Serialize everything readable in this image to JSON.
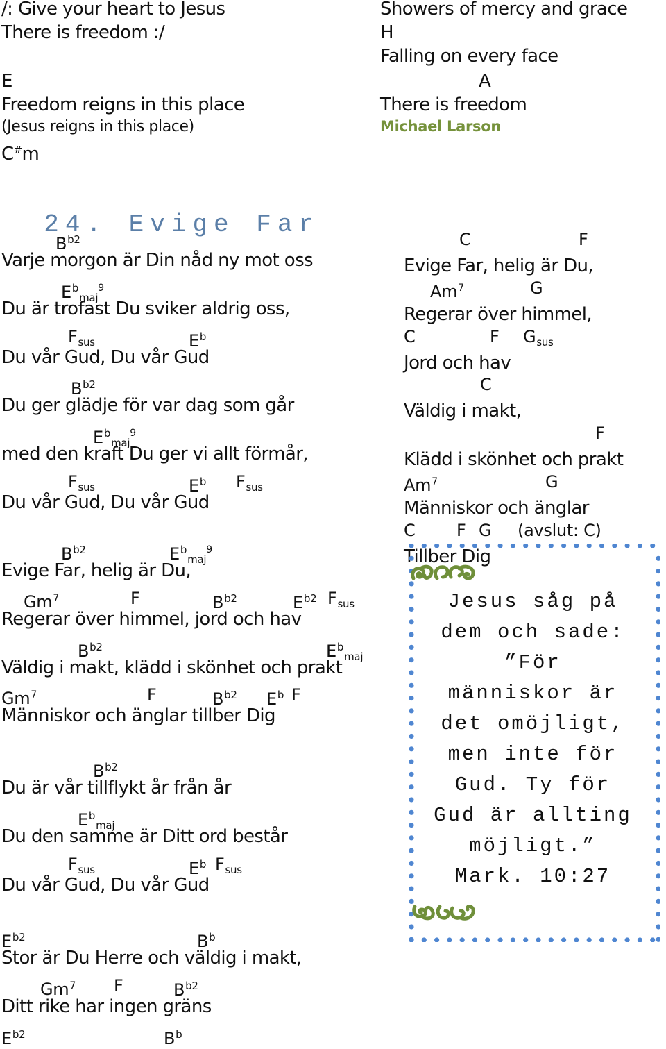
{
  "previous_song": {
    "left_lines": [
      {
        "type": "lyric",
        "text": "/: Give your heart to Jesus"
      },
      {
        "type": "lyric",
        "text": "There is freedom :/"
      },
      {
        "type": "chord",
        "text": "E"
      },
      {
        "type": "lyric",
        "text": "Freedom reigns in this place"
      },
      {
        "type": "small",
        "text": "(Jesus reigns in this place)"
      },
      {
        "type": "chord",
        "text": "C#m"
      }
    ],
    "right_lines": [
      {
        "type": "lyric",
        "text": "Showers of mercy and grace"
      },
      {
        "type": "chord",
        "text": "H"
      },
      {
        "type": "lyric",
        "text": "Falling on every face"
      },
      {
        "type": "chord",
        "text": "A"
      },
      {
        "type": "lyric",
        "text": "There is freedom"
      }
    ],
    "author": "Michael Larson"
  },
  "song": {
    "number": "24.",
    "title": "Evige Far",
    "verse1": [
      {
        "chords": [
          "Bb2"
        ],
        "lyric": "Varje morgon är Din nåd ny mot oss"
      },
      {
        "chords": [
          "Ebmaj9"
        ],
        "lyric": "Du är trofast Du sviker aldrig oss,"
      },
      {
        "chords": [
          "Fsus",
          "Eb"
        ],
        "lyric": "Du vår Gud, Du vår Gud"
      },
      {
        "chords": [
          "Bb2"
        ],
        "lyric": "Du ger glädje för var dag som går"
      },
      {
        "chords": [
          "Ebmaj9"
        ],
        "lyric": "med den kraft Du ger vi allt förmår,"
      },
      {
        "chords": [
          "Fsus",
          "Eb",
          "Fsus"
        ],
        "lyric": "Du vår Gud, Du vår Gud"
      }
    ],
    "chorus": [
      {
        "chords": [
          "Bb2",
          "Ebmaj9"
        ],
        "lyric": "Evige Far, helig är Du,"
      },
      {
        "chords": [
          "Gm7",
          "F",
          "Bb2",
          "Eb2",
          "Fsus"
        ],
        "lyric": "Regerar över himmel, jord och hav"
      },
      {
        "chords": [
          "Bb2",
          "Ebmaj"
        ],
        "lyric": "Väldig i makt, klädd i skönhet och prakt"
      },
      {
        "chords": [
          "Gm7",
          "F",
          "Bb2",
          "Eb",
          "F"
        ],
        "lyric": "Människor och änglar tillber Dig"
      }
    ],
    "verse2": [
      {
        "chords": [
          "Bb2"
        ],
        "lyric": "Du är vår tillflykt år från år"
      },
      {
        "chords": [
          "Ebmaj"
        ],
        "lyric": "Du den samme är Ditt ord består"
      },
      {
        "chords": [
          "Fsus",
          "Eb",
          "Fsus"
        ],
        "lyric": "Du vår Gud, Du vår Gud"
      }
    ],
    "bridge": [
      {
        "chords": [
          "Eb2",
          "Bb"
        ],
        "lyric": "Stor är Du Herre och väldig i makt,"
      },
      {
        "chords": [
          "Gm7",
          "F",
          "Bb2"
        ],
        "lyric": "Ditt rike har ingen gräns"
      },
      {
        "chords": [
          "Eb2",
          "Bb"
        ],
        "lyric": ""
      }
    ],
    "chorus_in_c": [
      {
        "chords": [
          "C",
          "F"
        ],
        "lyric": "Evige Far, helig är Du,"
      },
      {
        "chords": [
          "Am7",
          "G"
        ],
        "lyric": "Regerar över himmel,"
      },
      {
        "chords": [
          "C",
          "F",
          "Gsus"
        ],
        "lyric": "Jord och hav"
      },
      {
        "chords": [
          "C"
        ],
        "lyric": "Väldig i makt,"
      },
      {
        "chords": [
          "F"
        ],
        "lyric": "Klädd i skönhet och prakt"
      },
      {
        "chords": [
          "Am7",
          "G"
        ],
        "lyric": "Människor och änglar"
      },
      {
        "chords": [
          "C",
          "F",
          "G",
          "(avslut: C)"
        ],
        "lyric": "Tillber Dig"
      }
    ]
  },
  "quote_box": {
    "ornament_top": "ornament-flourish",
    "lines": [
      "Jesus såg på",
      "dem och sade:",
      "”För",
      "människor är",
      "det omöjligt,",
      "men inte för",
      "Gud. Ty för",
      "Gud är allting",
      "möjligt.”",
      "Mark. 10:27"
    ],
    "ornament_bottom": "ornament-flourish"
  },
  "colors": {
    "title": "#5b7fa8",
    "author": "#76923c",
    "ornament": "#6f8f3a",
    "dot_border": "#4f86d1",
    "text": "#111111"
  }
}
